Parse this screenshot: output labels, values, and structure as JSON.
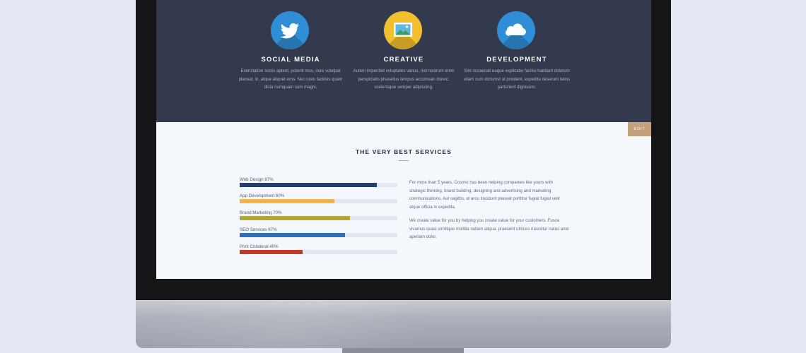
{
  "features": [
    {
      "title": "SOCIAL MEDIA",
      "icon": "twitter-bird-icon",
      "color": "#2f8fd6",
      "text": "Exercitation sociis aptent, potenti mus, irure volutpat placeat, in, atque aliquet eros. Nec iusto facilisis quam dicta numquam cum magni."
    },
    {
      "title": "CREATIVE",
      "icon": "picture-frame-icon",
      "color": "#f2c02e",
      "text": "Autem imperdiet voluptates varius, nisl nostrum enim perspiciatis phasellus tempus accumsan donec, scelerisque semper adipiscing."
    },
    {
      "title": "DEVELOPMENT",
      "icon": "cloud-icon",
      "color": "#2f8fd6",
      "text": "Sint occaecati eaque explicabo facilisi habitant dolorum ullam cum dictumst ut proident, expedita deserunt tellus parturient dignissim."
    }
  ],
  "services": {
    "edit_label": "EDIT",
    "title": "THE VERY BEST SERVICES",
    "skills": [
      {
        "label": "Web Design 87%",
        "percent": 87,
        "color": "#233f6b"
      },
      {
        "label": "App Development 60%",
        "percent": 60,
        "color": "#f0b54a"
      },
      {
        "label": "Brand Marketing 70%",
        "percent": 70,
        "color": "#b0a73a"
      },
      {
        "label": "SEO Services 67%",
        "percent": 67,
        "color": "#2c6fb6"
      },
      {
        "label": "Print Collateral 40%",
        "percent": 40,
        "color": "#c0392b"
      }
    ],
    "paragraphs": [
      "For more than 5 years, Cosmic has been helping companies like yours with strategic thinking, brand building, designing and advertising and marketing communications. Aut sagittis, at arcu tincidunt placeat porttitor fugiat fugiat velit atque officia in expedita.",
      "We create value for you by helping you create value for your customers. Fusce vivamus quasi similique mollitia nullam aliqua, praesent ultrices nascetur natus ante aperiam dolor."
    ]
  }
}
